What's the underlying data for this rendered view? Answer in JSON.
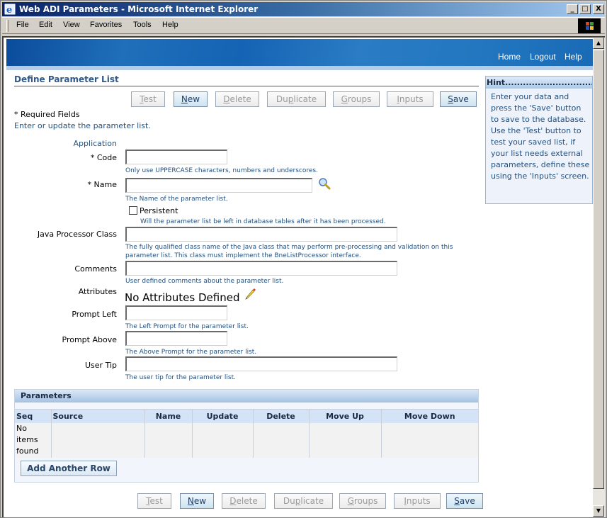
{
  "window": {
    "title": "Web ADI Parameters - Microsoft Internet Explorer",
    "controls": {
      "minimize": "_",
      "maximize": "□",
      "close": "X"
    }
  },
  "menubar": [
    "File",
    "Edit",
    "View",
    "Favorites",
    "Tools",
    "Help"
  ],
  "global_links": [
    "Home",
    "Logout",
    "Help"
  ],
  "page": {
    "title": "Define Parameter List",
    "required_note": "* Required Fields",
    "intro": "Enter or update the parameter list."
  },
  "buttons": [
    {
      "label": "Test",
      "accesskey": "T",
      "rest": "est",
      "active": false
    },
    {
      "label": "New",
      "accesskey": "N",
      "rest": "ew",
      "active": true
    },
    {
      "label": "Delete",
      "accesskey": "D",
      "rest": "elete",
      "active": false
    },
    {
      "label": "Duplicate",
      "pre": "Du",
      "accesskey": "p",
      "rest": "licate",
      "active": false
    },
    {
      "label": "Groups",
      "accesskey": "G",
      "rest": "roups",
      "active": false
    },
    {
      "label": "Inputs",
      "accesskey": "I",
      "rest": "nputs",
      "active": false
    },
    {
      "label": "Save",
      "accesskey": "S",
      "rest": "ave",
      "active": true
    }
  ],
  "form": {
    "application_label": "Application",
    "code": {
      "label": "* Code",
      "value": "",
      "tip": "Only use UPPERCASE characters, numbers and underscores."
    },
    "name": {
      "label": "* Name",
      "value": "",
      "tip": "The Name of the parameter list."
    },
    "persistent": {
      "label": "Persistent",
      "checked": false,
      "tip": "Will the parameter list be left in database tables after it has been processed."
    },
    "java_processor_class": {
      "label": "Java Processor Class",
      "value": "",
      "tip_line1": "The fully qualified class name of the Java class that may perform pre-processing and validation on this",
      "tip_line2": "parameter list. This class must implement the BneListProcessor interface."
    },
    "comments": {
      "label": "Comments",
      "value": "",
      "tip": "User defined comments about the parameter list."
    },
    "attributes": {
      "label": "Attributes",
      "value": "No Attributes Defined"
    },
    "prompt_left": {
      "label": "Prompt Left",
      "value": "",
      "tip": "The Left Prompt for the parameter list."
    },
    "prompt_above": {
      "label": "Prompt Above",
      "value": "",
      "tip": "The Above Prompt for the parameter list."
    },
    "user_tip": {
      "label": "User Tip",
      "value": "",
      "tip": "The user tip for the parameter list."
    }
  },
  "hint": {
    "title": "Hint.................................",
    "body": "Enter your data and press the 'Save' button to save to the database. Use the 'Test' button to test your saved list, if your list needs external parameters, define these using the 'Inputs' screen."
  },
  "parameters": {
    "title": "Parameters",
    "columns": [
      "Seq",
      "Source",
      "Name",
      "Update",
      "Delete",
      "Move Up",
      "Move Down"
    ],
    "empty_message_lines": [
      "No",
      "items",
      "found"
    ],
    "add_row_label": "Add Another Row"
  }
}
